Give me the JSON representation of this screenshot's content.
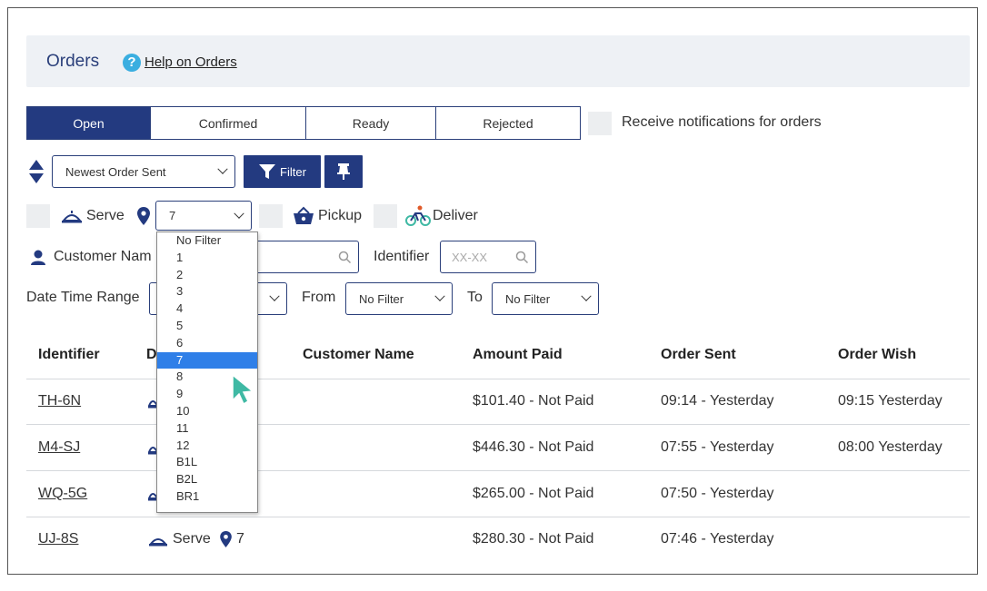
{
  "header": {
    "title": "Orders",
    "help_link": "Help on Orders"
  },
  "tabs": [
    {
      "label": "Open",
      "active": true
    },
    {
      "label": "Confirmed",
      "active": false
    },
    {
      "label": "Ready",
      "active": false
    },
    {
      "label": "Rejected",
      "active": false
    }
  ],
  "notifications_label": "Receive notifications for orders",
  "sort": {
    "selected": "Newest Order Sent"
  },
  "buttons": {
    "filter": "Filter"
  },
  "delivery_filters": {
    "serve": "Serve",
    "table_selected": "7",
    "pickup": "Pickup",
    "deliver": "Deliver"
  },
  "table_dropdown_options": [
    "No Filter",
    "1",
    "2",
    "3",
    "4",
    "5",
    "6",
    "7",
    "8",
    "9",
    "10",
    "11",
    "12",
    "B1L",
    "B2L",
    "BR1"
  ],
  "table_dropdown_selected": "7",
  "customer_name_label": "Customer Nam",
  "identifier_label": "Identifier",
  "identifier_placeholder": "XX-XX",
  "date_range_label": "Date Time Range",
  "from_label": "From",
  "from_value": "No Filter",
  "to_label": "To",
  "to_value": "No Filter",
  "columns": {
    "identifier": "Identifier",
    "delivery": "D",
    "customer_name": "Customer Name",
    "amount_paid": "Amount Paid",
    "order_sent": "Order Sent",
    "order_wish": "Order Wish"
  },
  "orders": [
    {
      "identifier": "TH-6N",
      "amount": "$101.40 - Not Paid",
      "sent": "09:14 - Yesterday",
      "wish": "09:15 Yesterday"
    },
    {
      "identifier": "M4-SJ",
      "amount": "$446.30 - Not Paid",
      "sent": "07:55 - Yesterday",
      "wish": "08:00 Yesterday"
    },
    {
      "identifier": "WQ-5G",
      "amount": "$265.00 - Not Paid",
      "sent": "07:50 - Yesterday",
      "wish": ""
    },
    {
      "identifier": "UJ-8S",
      "amount": "$280.30 - Not Paid",
      "sent": "07:46 - Yesterday",
      "wish": "",
      "delivery_label": "Serve",
      "table": "7"
    }
  ],
  "colors": {
    "primary": "#233a80",
    "selected": "#2f7fe8",
    "help": "#3aaee0",
    "cursor": "#3fb9a4"
  }
}
